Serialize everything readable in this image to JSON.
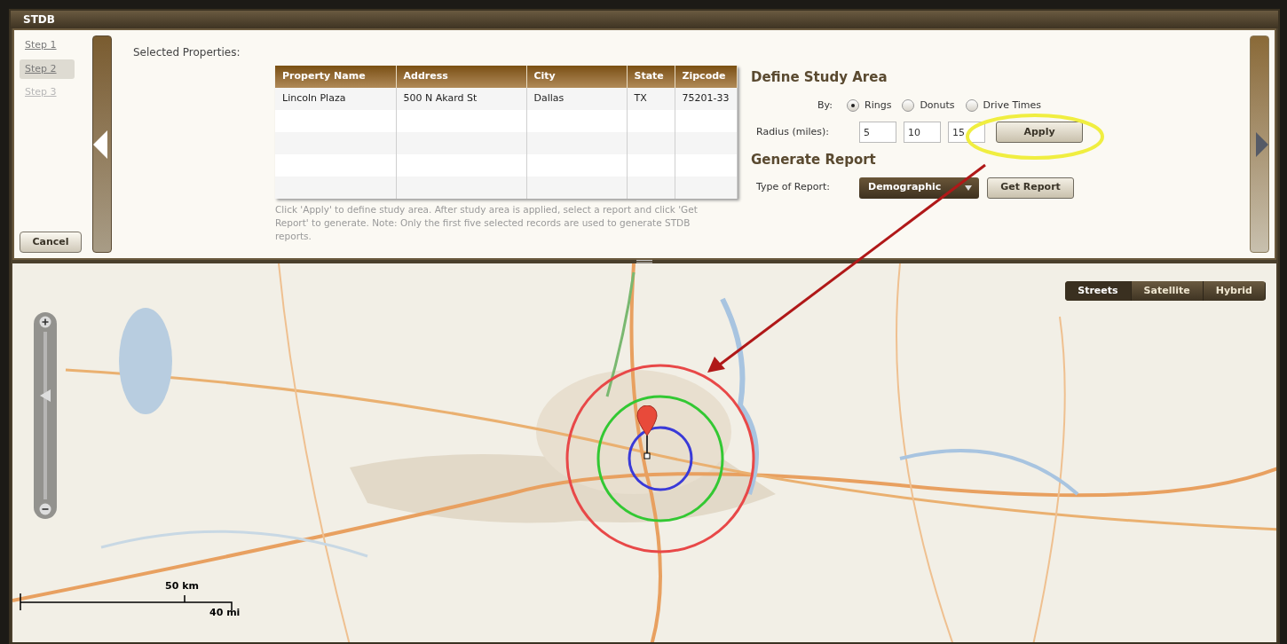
{
  "window": {
    "title": "STDB"
  },
  "steps": [
    {
      "label": "Step 1",
      "selected": false,
      "disabled": false
    },
    {
      "label": "Step 2",
      "selected": true,
      "disabled": false
    },
    {
      "label": "Step 3",
      "selected": false,
      "disabled": true
    }
  ],
  "cancel_button": "Cancel",
  "selected_properties": {
    "label": "Selected Properties:",
    "columns": [
      "Property Name",
      "Address",
      "City",
      "State",
      "Zipcode"
    ],
    "rows": [
      [
        "Lincoln Plaza",
        "500 N Akard St",
        "Dallas",
        "TX",
        "75201-33"
      ]
    ],
    "note": "Click 'Apply' to define study area. After study area is applied, select a report and click 'Get Report' to generate. Note: Only the first five selected records are used to generate STDB reports."
  },
  "study_area": {
    "title": "Define Study Area",
    "by_label": "By:",
    "options": [
      {
        "label": "Rings",
        "selected": true
      },
      {
        "label": "Donuts",
        "selected": false
      },
      {
        "label": "Drive Times",
        "selected": false
      }
    ],
    "radius_label": "Radius (miles):",
    "radii": [
      "5",
      "10",
      "15"
    ],
    "apply_button": "Apply"
  },
  "report": {
    "title": "Generate Report",
    "type_label": "Type of Report:",
    "type_value": "Demographic",
    "get_button": "Get Report"
  },
  "map": {
    "kind": "picture",
    "types": [
      {
        "label": "Streets",
        "selected": true
      },
      {
        "label": "Satellite",
        "selected": false
      },
      {
        "label": "Hybrid",
        "selected": false
      }
    ],
    "zoom": {
      "level": 0.62
    },
    "rings": [
      {
        "color": "#3a3ad8"
      },
      {
        "color": "#33c833"
      },
      {
        "color": "#e84848"
      }
    ],
    "scale": {
      "metric": "50 km",
      "imperial": "40 mi"
    }
  }
}
